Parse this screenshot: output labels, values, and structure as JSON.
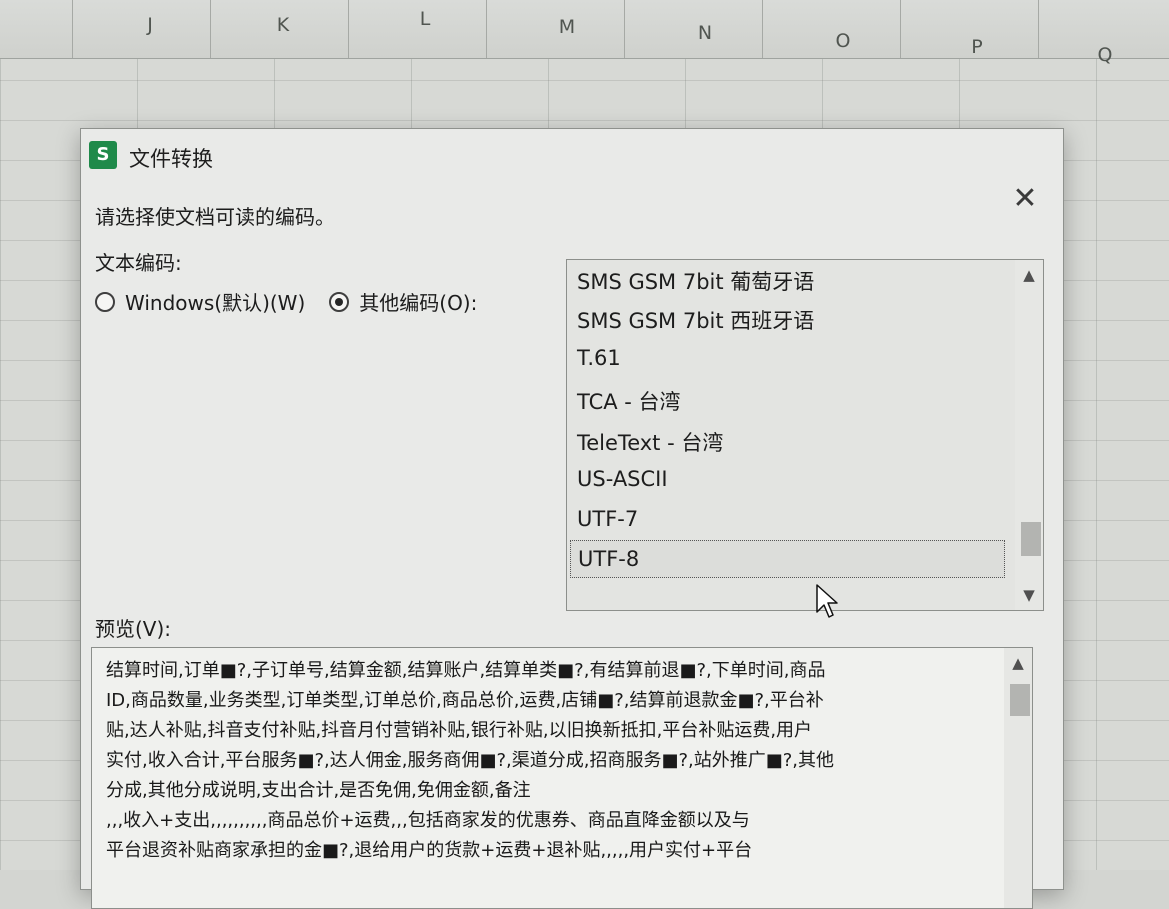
{
  "columns": [
    "J",
    "K",
    "L",
    "M",
    "N",
    "O",
    "P",
    "Q"
  ],
  "dialog": {
    "title": "文件转换",
    "app_icon": "S",
    "close_label": "✕",
    "instruction": "请选择使文档可读的编码。",
    "encoding_label": "文本编码:",
    "radio_windows": "Windows(默认)(W)",
    "radio_other": "其他编码(O):",
    "selected_radio": "other",
    "encodings": [
      "SMS GSM 7bit 葡萄牙语",
      "SMS GSM 7bit 西班牙语",
      "T.61",
      "TCA - 台湾",
      "TeleText - 台湾",
      "US-ASCII",
      "UTF-7",
      "UTF-8"
    ],
    "selected_encoding": "UTF-8",
    "preview_label": "预览(V):",
    "preview_lines": [
      "结算时间,订单■?,子订单号,结算金额,结算账户,结算单类■?,有结算前退■?,下单时间,商品",
      "ID,商品数量,业务类型,订单类型,订单总价,商品总价,运费,店铺■?,结算前退款金■?,平台补",
      "贴,达人补贴,抖音支付补贴,抖音月付营销补贴,银行补贴,以旧换新抵扣,平台补贴运费,用户",
      "实付,收入合计,平台服务■?,达人佣金,服务商佣■?,渠道分成,招商服务■?,站外推广■?,其他",
      "分成,其他分成说明,支出合计,是否免佣,免佣金额,备注",
      ",,,收入+支出,,,,,,,,,,商品总价+运费,,,包括商家发的优惠券、商品直降金额以及与",
      "平台退资补贴商家承担的金■?,退给用户的货款+运费+退补贴,,,,,用户实付+平台"
    ]
  }
}
